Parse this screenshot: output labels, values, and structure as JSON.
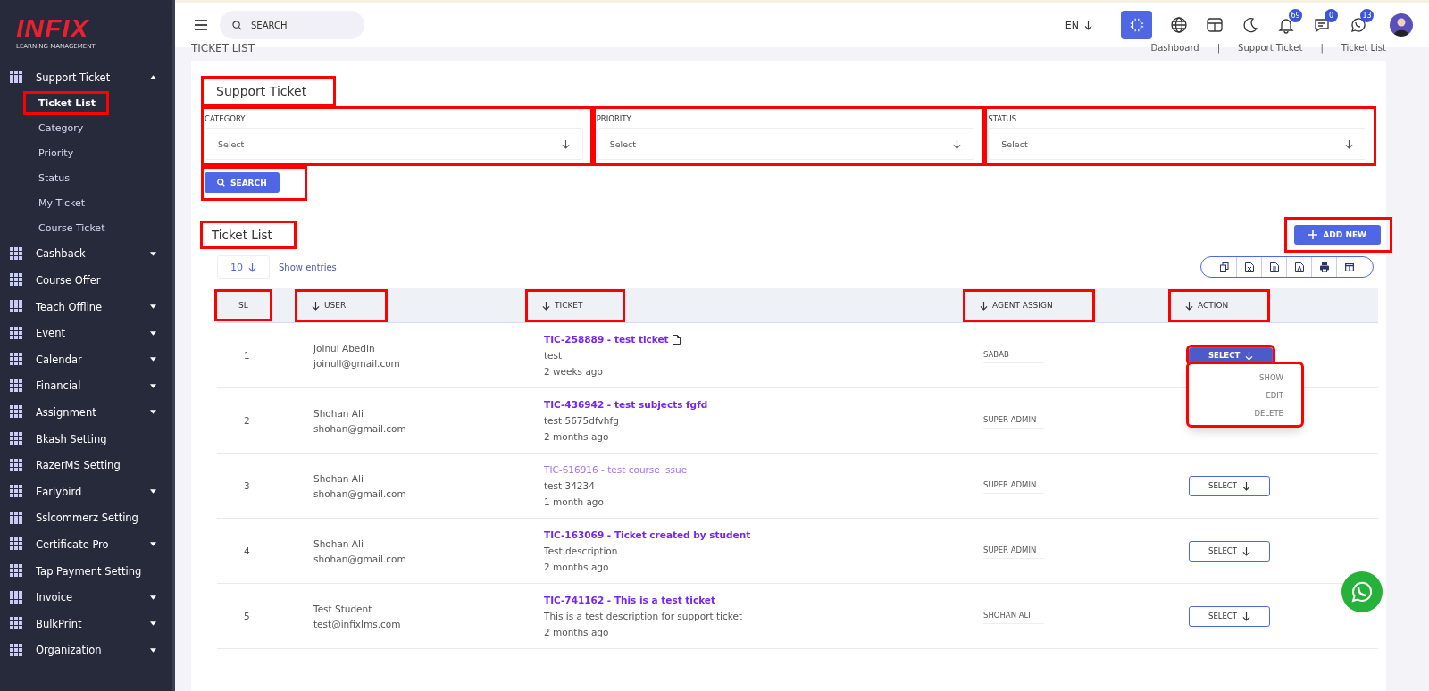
{
  "brand": {
    "logo": "INFIX",
    "tagline": "LEARNING MANAGEMENT"
  },
  "sidebar": {
    "items": [
      {
        "label": "Support Ticket",
        "kind": "group",
        "expanded": true,
        "children": [
          {
            "label": "Ticket List",
            "selected": true,
            "highlighted": true
          },
          {
            "label": "Category",
            "selected": false,
            "highlighted": false
          },
          {
            "label": "Priority",
            "selected": false,
            "highlighted": false
          },
          {
            "label": "Status",
            "selected": false,
            "highlighted": false
          },
          {
            "label": "My Ticket",
            "selected": false,
            "highlighted": false
          },
          {
            "label": "Course Ticket",
            "selected": false,
            "highlighted": false
          }
        ]
      },
      {
        "label": "Cashback",
        "kind": "group",
        "expanded": false
      },
      {
        "label": "Course Offer",
        "kind": "link"
      },
      {
        "label": "Teach Offline",
        "kind": "group",
        "expanded": false
      },
      {
        "label": "Event",
        "kind": "group",
        "expanded": false
      },
      {
        "label": "Calendar",
        "kind": "group",
        "expanded": false
      },
      {
        "label": "Financial",
        "kind": "group",
        "expanded": false
      },
      {
        "label": "Assignment",
        "kind": "group",
        "expanded": false
      },
      {
        "label": "Bkash Setting",
        "kind": "link"
      },
      {
        "label": "RazerMS Setting",
        "kind": "link"
      },
      {
        "label": "Earlybird",
        "kind": "group",
        "expanded": false
      },
      {
        "label": "Sslcommerz Setting",
        "kind": "link"
      },
      {
        "label": "Certificate Pro",
        "kind": "group",
        "expanded": false
      },
      {
        "label": "Tap Payment Setting",
        "kind": "link"
      },
      {
        "label": "Invoice",
        "kind": "group",
        "expanded": false
      },
      {
        "label": "BulkPrint",
        "kind": "group",
        "expanded": false
      },
      {
        "label": "Organization",
        "kind": "group",
        "expanded": false
      }
    ]
  },
  "topbar": {
    "search": {
      "placeholder": "SEARCH"
    },
    "language": "EN",
    "notifications": "69",
    "messages": "0",
    "chats": "13"
  },
  "page_title": "TICKET LIST",
  "breadcrumb": [
    "Dashboard",
    "Support Ticket",
    "Ticket List"
  ],
  "breadcrumb_separator": "|",
  "filter": {
    "title": "Support Ticket",
    "title_highlighted": true,
    "fields": [
      {
        "label": "CATEGORY",
        "placeholder": "Select",
        "highlighted": true
      },
      {
        "label": "PRIORITY",
        "placeholder": "Select",
        "highlighted": true
      },
      {
        "label": "STATUS",
        "placeholder": "Select",
        "highlighted": true
      }
    ],
    "search_button": "SEARCH",
    "search_highlighted": true
  },
  "ticket_list": {
    "title": "Ticket List",
    "title_highlighted": true,
    "add_button": "ADD NEW",
    "add_highlighted": true,
    "page_size": "10",
    "show_entries": "Show entries",
    "columns": [
      {
        "label": "SL",
        "sortable": false,
        "highlighted": true
      },
      {
        "label": "USER",
        "sortable": true,
        "highlighted": true
      },
      {
        "label": "TICKET",
        "sortable": true,
        "highlighted": true
      },
      {
        "label": "AGENT ASSIGN",
        "sortable": true,
        "highlighted": true
      },
      {
        "label": "ACTION",
        "sortable": true,
        "highlighted": true
      }
    ],
    "rows": [
      {
        "sl": "1",
        "name": "Joinul Abedin",
        "email": "joinull@gmail.com",
        "ticket": "TIC-258889 - test ticket",
        "attachment": true,
        "visited": false,
        "description": "test",
        "time": "2 weeks ago",
        "agent": "SABAB",
        "action": "SELECT",
        "open": true,
        "highlighted": true
      },
      {
        "sl": "2",
        "name": "Shohan Ali",
        "email": "shohan@gmail.com",
        "ticket": "TIC-436942 - test subjects fgfd",
        "attachment": false,
        "visited": false,
        "description": "test 5675dfvhfg",
        "time": "2 months ago",
        "agent": "SUPER ADMIN"
      },
      {
        "sl": "3",
        "name": "Shohan Ali",
        "email": "shohan@gmail.com",
        "ticket": "TIC-616916 - test course issue",
        "attachment": false,
        "visited": true,
        "description": "test 34234",
        "time": "1 month ago",
        "agent": "SUPER ADMIN",
        "action": "SELECT",
        "open": false,
        "highlighted": false
      },
      {
        "sl": "4",
        "name": "Shohan Ali",
        "email": "shohan@gmail.com",
        "ticket": "TIC-163069 - Ticket created by student",
        "attachment": false,
        "visited": false,
        "description": "Test description",
        "time": "2 months ago",
        "agent": "SUPER ADMIN",
        "action": "SELECT",
        "open": false,
        "highlighted": false
      },
      {
        "sl": "5",
        "name": "Test Student",
        "email": "test@infixlms.com",
        "ticket": "TIC-741162 - This is a test ticket",
        "attachment": false,
        "visited": false,
        "description": "This is a test description for support ticket",
        "time": "2 months ago",
        "agent": "SHOHAN ALI",
        "action": "SELECT",
        "open": false,
        "highlighted": false
      }
    ],
    "action_menu": {
      "items": [
        "SHOW",
        "EDIT",
        "DELETE"
      ],
      "highlighted": true
    }
  }
}
